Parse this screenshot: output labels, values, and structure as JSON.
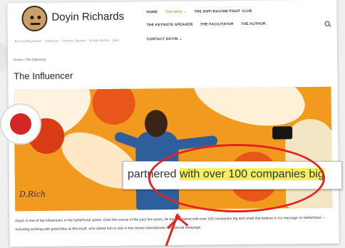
{
  "site": {
    "title": "Doyin Richards",
    "tagline": "Best-Selling Author · Influencer · Keynote Speaker · Bridge-Builder · Dad"
  },
  "nav": {
    "row1": [
      "HOME",
      "THE MAN ⌄",
      "THE ANTI-RACISM FIGHT CLUB"
    ],
    "row2": [
      "THE KEYNOTE SPEAKER",
      "THE FACILITATOR",
      "THE AUTHOR"
    ],
    "row3": [
      "CONTACT DOYIN ⌄"
    ]
  },
  "breadcrumb": "Home » The Influencer",
  "page_title": "The Influencer",
  "zoom": {
    "before": "partnered ",
    "highlight": "with over 100 companies big"
  },
  "body_text": "Doyin is one of top influencers in the fatherhood space. Over the course of the past few years, he has partnered with over 100 companies big and small that believe in his message on fatherhood — including working with good folks at Microsoft, who asked him to star in this recent international commercial campaign.",
  "colors": {
    "annotation": "#e42420",
    "highlight": "#f3f05c",
    "nav_active": "#c8a24b"
  },
  "icons": {
    "search": "search-icon",
    "logo": "avatar-logo"
  }
}
